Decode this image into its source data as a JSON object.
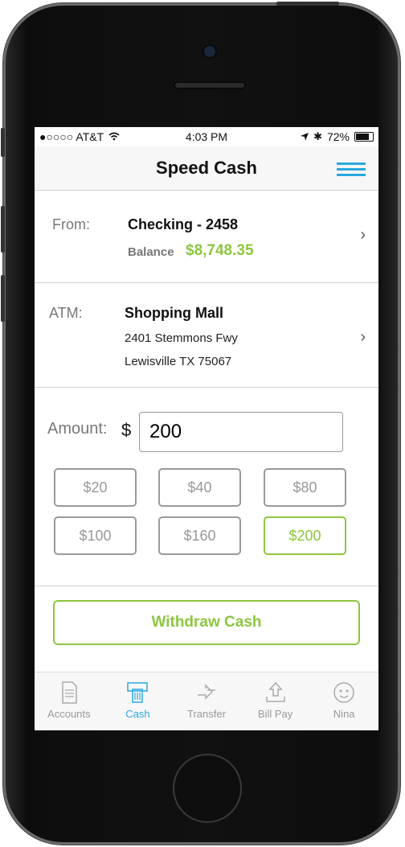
{
  "status": {
    "carrier": "●○○○○ AT&T",
    "wifi": "wifi-icon",
    "time": "4:03 PM",
    "location": "location-arrow-icon",
    "bluetooth": "bluetooth-icon",
    "battery": "72%"
  },
  "nav": {
    "title": "Speed Cash",
    "menu_icon": "menu-icon"
  },
  "from": {
    "label": "From:",
    "account": "Checking - 2458",
    "balance_label": "Balance",
    "balance_value": "$8,748.35"
  },
  "atm": {
    "label": "ATM:",
    "name": "Shopping Mall",
    "address1": "2401 Stemmons Fwy",
    "address2": "Lewisville TX 75067"
  },
  "amount": {
    "label": "Amount:",
    "currency": "$",
    "value": "200"
  },
  "quick": [
    "$20",
    "$40",
    "$80",
    "$100",
    "$160",
    "$200"
  ],
  "selected_quick": "$200",
  "withdraw": "Withdraw Cash",
  "tabs": [
    {
      "label": "Accounts",
      "icon": "document-icon"
    },
    {
      "label": "Cash",
      "icon": "atm-card-icon"
    },
    {
      "label": "Transfer",
      "icon": "transfer-arrows-icon"
    },
    {
      "label": "Bill Pay",
      "icon": "upload-tray-icon"
    },
    {
      "label": "Nina",
      "icon": "assistant-face-icon"
    }
  ],
  "active_tab": "Cash",
  "colors": {
    "accent_green": "#8cc63f",
    "accent_blue": "#2aa8e0"
  }
}
